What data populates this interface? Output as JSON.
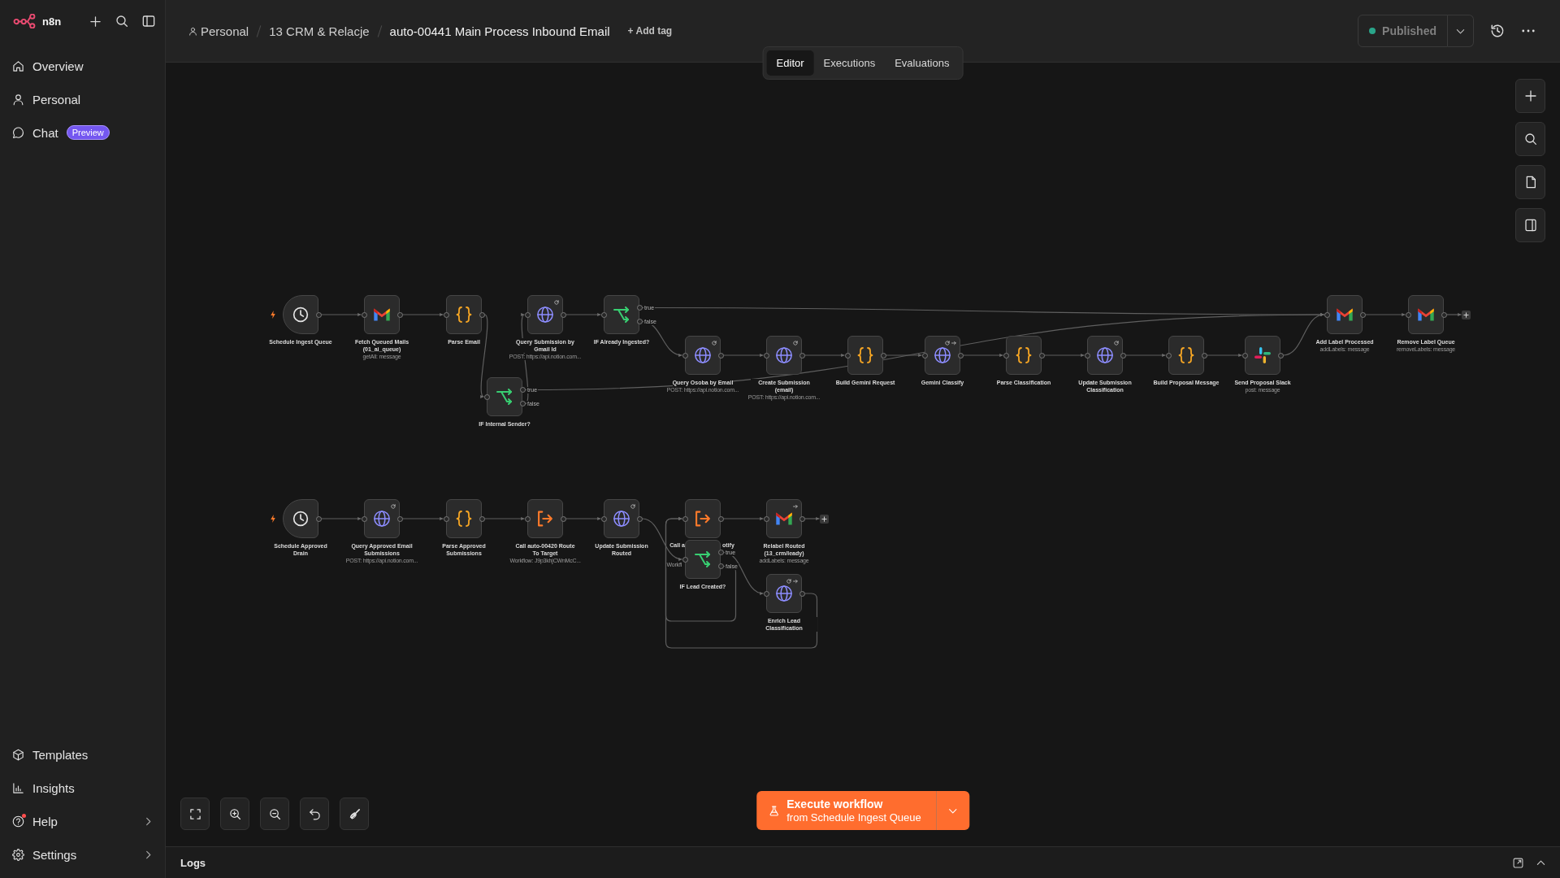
{
  "sidebar": {
    "brand": "n8n",
    "nav": [
      {
        "label": "Overview",
        "selected": false
      },
      {
        "label": "Personal",
        "selected": false
      },
      {
        "label": "Chat",
        "selected": false,
        "badge": "Preview"
      }
    ],
    "footer_nav": [
      {
        "label": "Templates",
        "selected": false,
        "notification": false,
        "expandable": false
      },
      {
        "label": "Insights",
        "selected": false,
        "notification": false,
        "expandable": false
      },
      {
        "label": "Help",
        "selected": false,
        "notification": true,
        "expandable": true
      },
      {
        "label": "Settings",
        "selected": false,
        "notification": false,
        "expandable": true
      }
    ]
  },
  "header": {
    "breadcrumb": [
      "Personal",
      "13 CRM & Relacje",
      "auto-00441 Main Process Inbound Email"
    ],
    "add_tag": "+ Add tag",
    "tabs": [
      {
        "label": "Editor",
        "selected": true
      },
      {
        "label": "Executions",
        "selected": false
      },
      {
        "label": "Evaluations",
        "selected": false
      }
    ],
    "publish": {
      "label": "Published",
      "active": true
    }
  },
  "canvas": {
    "nodes": [
      {
        "name": "Schedule Ingest Queue",
        "kind": "schedule",
        "retry": false,
        "forward": false
      },
      {
        "name": "Fetch Queued Mails (01_ai_queue)",
        "kind": "gmail",
        "subtitle": "getAll: message",
        "retry": false,
        "forward": false
      },
      {
        "name": "Parse Email",
        "kind": "code",
        "retry": false,
        "forward": false
      },
      {
        "name": "IF Internal Sender?",
        "kind": "if",
        "outputs": [
          "true",
          "false"
        ],
        "retry": false,
        "forward": false
      },
      {
        "name": "Query Submission by Gmail Id",
        "kind": "http",
        "subtitle": "POST: https://api.notion.com...",
        "retry": true,
        "forward": false
      },
      {
        "name": "IF Already Ingested?",
        "kind": "if",
        "outputs": [
          "true",
          "false"
        ],
        "retry": false,
        "forward": false
      },
      {
        "name": "Query Osoba by Email",
        "kind": "http",
        "subtitle": "POST: https://api.notion.com...",
        "retry": true,
        "forward": false
      },
      {
        "name": "Create Submission (email)",
        "kind": "http",
        "subtitle": "POST: https://api.notion.com...",
        "retry": true,
        "forward": false
      },
      {
        "name": "Build Gemini Request",
        "kind": "code",
        "retry": false,
        "forward": false
      },
      {
        "name": "Gemini Classify",
        "kind": "http",
        "retry": true,
        "forward": true
      },
      {
        "name": "Parse Classification",
        "kind": "code",
        "retry": false,
        "forward": false
      },
      {
        "name": "Update Submission Classification",
        "kind": "http",
        "retry": true,
        "forward": false
      },
      {
        "name": "Build Proposal Message",
        "kind": "code",
        "retry": false,
        "forward": false
      },
      {
        "name": "Send Proposal Slack",
        "kind": "slack",
        "subtitle": "post: message",
        "retry": false,
        "forward": false
      },
      {
        "name": "Add Label Processed",
        "kind": "gmail",
        "subtitle": "addLabels: message",
        "retry": false,
        "forward": false
      },
      {
        "name": "Remove Label Queue",
        "kind": "gmail",
        "subtitle": "removeLabels: message",
        "retry": false,
        "forward": false
      },
      {
        "name": "Schedule Approved Drain",
        "kind": "schedule",
        "retry": false,
        "forward": false
      },
      {
        "name": "Query Approved Email Submissions",
        "kind": "http",
        "subtitle": "POST: https://api.notion.com...",
        "retry": true,
        "forward": false
      },
      {
        "name": "Parse Approved Submissions",
        "kind": "code",
        "retry": false,
        "forward": false
      },
      {
        "name": "Call auto-00420 Route To Target",
        "kind": "subworkflow",
        "subtitle": "Workflow: J9p3khjCWnMcC...",
        "retry": false,
        "forward": false
      },
      {
        "name": "Update Submission Routed",
        "kind": "http",
        "retry": true,
        "forward": false
      },
      {
        "label_parts": [
          "Call a",
          "otify"
        ],
        "kind": "subworkflow",
        "subtitle": "Workfl",
        "retry": false,
        "forward": false
      },
      {
        "name": "IF Lead Created?",
        "kind": "if",
        "outputs": [
          "true",
          "false"
        ],
        "retry": false,
        "forward": false
      },
      {
        "name": "Relabel Routed (13_crm/leady)",
        "kind": "gmail",
        "subtitle": "addLabels: message",
        "retry": false,
        "forward": true
      },
      {
        "name": "Enrich Lead Classification",
        "kind": "http",
        "retry": true,
        "forward": true
      }
    ],
    "execute": {
      "label": "Execute workflow",
      "source": "from Schedule Ingest Queue"
    }
  },
  "logs": {
    "title": "Logs"
  }
}
